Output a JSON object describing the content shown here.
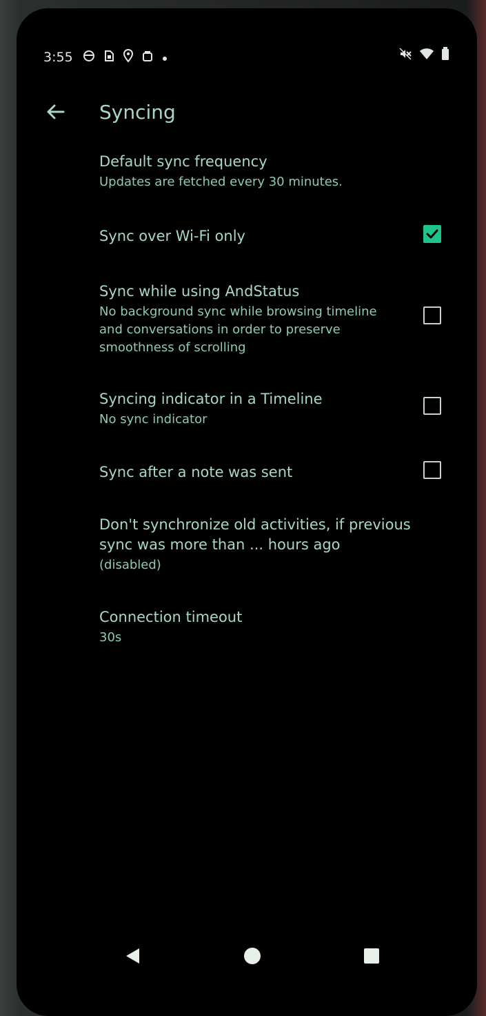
{
  "status_bar": {
    "time": "3:55",
    "left_icons": [
      "app-icon",
      "sim-icon",
      "location-icon",
      "bag-icon",
      "dot-icon"
    ],
    "right_icons": [
      "mute-icon",
      "wifi-icon",
      "battery-icon"
    ]
  },
  "app_bar": {
    "title": "Syncing",
    "back_icon": "back-arrow-icon"
  },
  "settings": [
    {
      "title": "Default sync frequency",
      "summary": "Updates are fetched every 30 minutes."
    },
    {
      "title": "Sync over Wi-Fi only",
      "checked": true
    },
    {
      "title": "Sync while using AndStatus",
      "summary": "No background sync while browsing timeline and conversations in order to preserve smoothness of scrolling",
      "checked": false
    },
    {
      "title": "Syncing indicator in a Timeline",
      "summary": "No sync indicator",
      "checked": false
    },
    {
      "title": "Sync after a note was sent",
      "checked": false
    },
    {
      "title": "Don't synchronize old activities, if previous sync was more than ... hours ago",
      "summary": "(disabled)"
    },
    {
      "title": "Connection timeout",
      "summary": "30s"
    }
  ],
  "nav_bar": {
    "icons": [
      "back-triangle-icon",
      "home-circle-icon",
      "recents-square-icon"
    ]
  },
  "colors": {
    "accent": "#1fc48b",
    "text_primary": "#a9d6c8",
    "text_secondary": "#8fc9b8"
  }
}
